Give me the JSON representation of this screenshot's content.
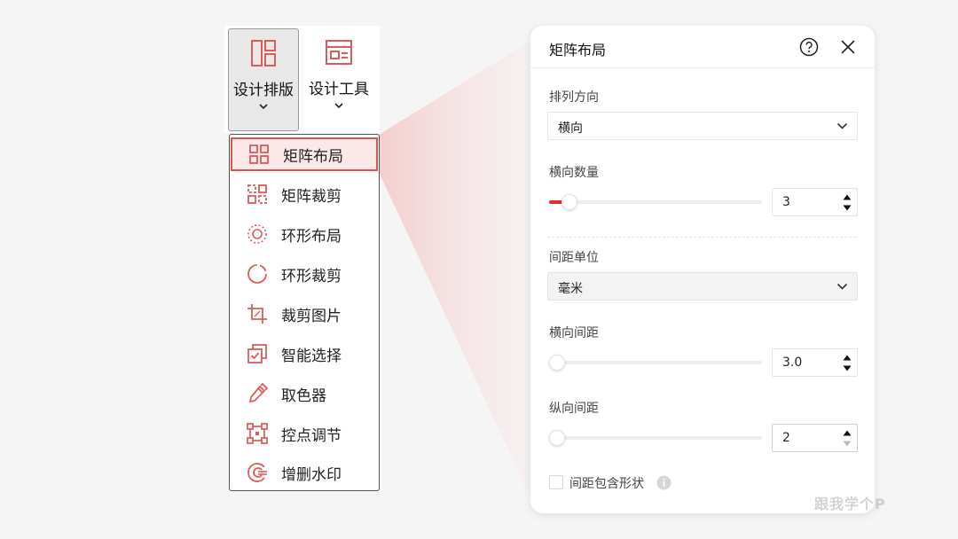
{
  "toolbar": {
    "design_layout": {
      "label": "设计排版",
      "icon": "layout-columns-icon"
    },
    "design_tools": {
      "label": "设计工具",
      "icon": "layout-panel-icon"
    }
  },
  "menu": {
    "items": [
      {
        "label": "矩阵布局",
        "icon": "matrix-grid-icon",
        "selected": true
      },
      {
        "label": "矩阵裁剪",
        "icon": "matrix-crop-icon",
        "selected": false
      },
      {
        "label": "环形布局",
        "icon": "ring-layout-icon",
        "selected": false
      },
      {
        "label": "环形裁剪",
        "icon": "ring-crop-icon",
        "selected": false
      },
      {
        "label": "裁剪图片",
        "icon": "crop-image-icon",
        "selected": false
      },
      {
        "label": "智能选择",
        "icon": "smart-select-icon",
        "selected": false
      },
      {
        "label": "取色器",
        "icon": "eyedropper-icon",
        "selected": false
      },
      {
        "label": "控点调节",
        "icon": "control-points-icon",
        "selected": false
      },
      {
        "label": "增删水印",
        "icon": "watermark-icon",
        "selected": false
      }
    ]
  },
  "panel": {
    "title": "矩阵布局",
    "arrangement": {
      "label": "排列方向",
      "value": "横向"
    },
    "horizontal_count": {
      "label": "横向数量",
      "value": "3",
      "slider_fraction": 0.06
    },
    "spacing_unit": {
      "label": "间距单位",
      "value": "毫米"
    },
    "horizontal_spacing": {
      "label": "横向间距",
      "value": "3.0",
      "slider_fraction": 0.0
    },
    "vertical_spacing": {
      "label": "纵向间距",
      "value": "2",
      "slider_fraction": 0.0
    },
    "include_shape": {
      "label": "间距包含形状",
      "checked": false
    }
  },
  "watermark": "跟我学个P",
  "colors": {
    "accent": "#e0302b",
    "icon_red": "#e05a5a",
    "selected_bg": "#fbe8e8"
  }
}
